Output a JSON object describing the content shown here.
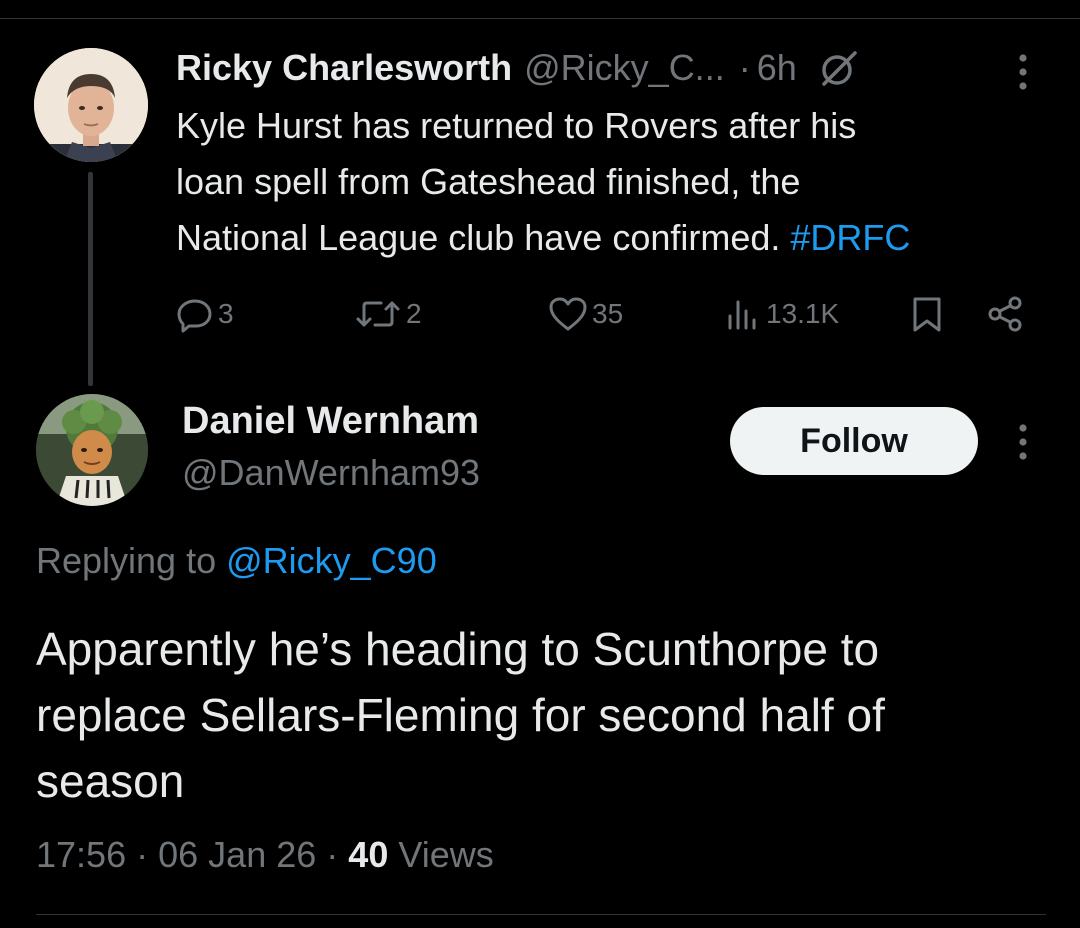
{
  "colors": {
    "background": "#000000",
    "primary_text": "#e7e9ea",
    "secondary_text": "#71767b",
    "link": "#1d9bf0",
    "divider": "#2f3336",
    "follow_button_bg": "#eff3f4",
    "follow_button_text": "#0f1419"
  },
  "parent_tweet": {
    "author_name": "Ricky Charlesworth",
    "author_handle": "@Ricky_C...",
    "separator": "·",
    "time": "6h",
    "grok_icon": "grok-icon",
    "more_icon": "more-vertical-icon",
    "text_lines": [
      "Kyle Hurst has returned to Rovers after his",
      "loan spell from Gateshead finished, the",
      "National League club have confirmed. "
    ],
    "hashtag": "#DRFC",
    "actions": {
      "replies": "3",
      "reposts": "2",
      "likes": "35",
      "views": "13.1K"
    }
  },
  "reply_tweet": {
    "author_name": "Daniel Wernham",
    "author_handle": "@DanWernham93",
    "follow_label": "Follow",
    "more_icon": "more-vertical-icon",
    "replying_prefix": "Replying to ",
    "replying_to": "@Ricky_C90",
    "text_lines": [
      "Apparently he’s heading to Scunthorpe to",
      "replace Sellars-Fleming for second half of",
      "season"
    ],
    "time": "17:56",
    "date": "06 Jan 26",
    "separator": "·",
    "views_count": "40",
    "views_label": "Views"
  }
}
